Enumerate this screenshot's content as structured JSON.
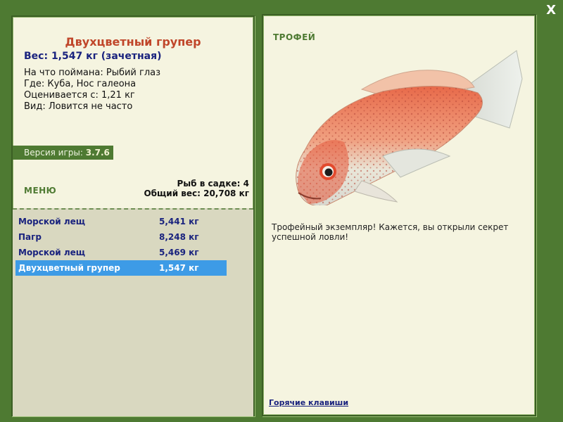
{
  "window": {
    "close_label": "X"
  },
  "fish": {
    "name": "Двухцветный групер",
    "weight_line": "Вес: 1,547 кг (зачетная)",
    "caught_on": "На что поймана: Рыбий глаз",
    "location": "Где: Куба, Нос галеона",
    "rated_from": "Оценивается с: 1,21 кг",
    "kind": "Вид: Ловится не часто"
  },
  "version": {
    "label": "Версия игры:",
    "value": "3.7.6"
  },
  "menu": {
    "label": "МЕНЮ"
  },
  "cage": {
    "fish_count": "Рыб в садке: 4",
    "total_weight": "Общий вес: 20,708 кг"
  },
  "catches": [
    {
      "name": "Морской лещ",
      "weight": "5,441 кг",
      "selected": false
    },
    {
      "name": "Пагр",
      "weight": "8,248 кг",
      "selected": false
    },
    {
      "name": "Морской лещ",
      "weight": "5,469 кг",
      "selected": false
    },
    {
      "name": "Двухцветный групер",
      "weight": "1,547 кг",
      "selected": true
    }
  ],
  "trophy": {
    "label": "ТРОФЕЙ",
    "description": "Трофейный экземпляр! Кажется, вы открыли секрет успешной ловли!"
  },
  "footer": {
    "hotkeys_label": "Горячие клавиши"
  },
  "colors": {
    "frame_green": "#4e7a32",
    "title_red": "#c0462a",
    "text_navy": "#1a237e",
    "selection_blue": "#3d9be6"
  }
}
